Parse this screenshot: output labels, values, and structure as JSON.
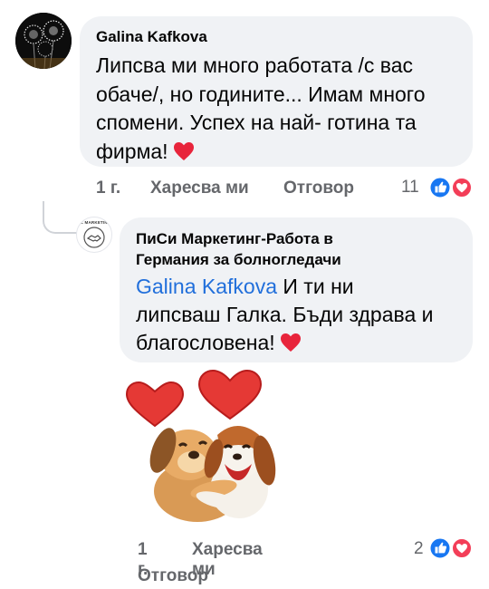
{
  "comment": {
    "author": "Galina Kafkova",
    "text": "Липсва ми много работата /с вас обаче/, но годините... Имам много спомени. Успех на най- готина та фирма!",
    "time": "1 г.",
    "like_label": "Харесва ми",
    "reply_label": "Отговор",
    "reaction_count": "11",
    "reactions": [
      "like-icon",
      "love-icon"
    ]
  },
  "reply": {
    "author": "ПиСи Маркетинг-Работа в Германия за болногледачи",
    "author_line1": "ПиСи Маркетинг-Работа в",
    "author_line2": "Германия за болногледачи",
    "avatar_text": "PC MARKETING",
    "mention": "Galina Kafkova",
    "text": "И ти ни липсваш Галка. Бъди здрава и благословена!",
    "text_line1": "И ти ни",
    "text_line2": "липсваш Галка. Бъди здрава и",
    "text_line3": "благословена!",
    "sticker": "hugging-dogs-with-hearts-sticker",
    "time": "1 г.",
    "like_label": "Харесва ми",
    "reply_label": "Отговор",
    "reaction_count": "2",
    "reactions": [
      "like-icon",
      "love-icon"
    ]
  },
  "colors": {
    "bubble": "#f0f2f5",
    "meta_text": "#65676b",
    "mention": "#216fdb",
    "like_blue": "#1877f2",
    "love_red": "#f33e58",
    "heart_emoji": "#e8243b"
  }
}
